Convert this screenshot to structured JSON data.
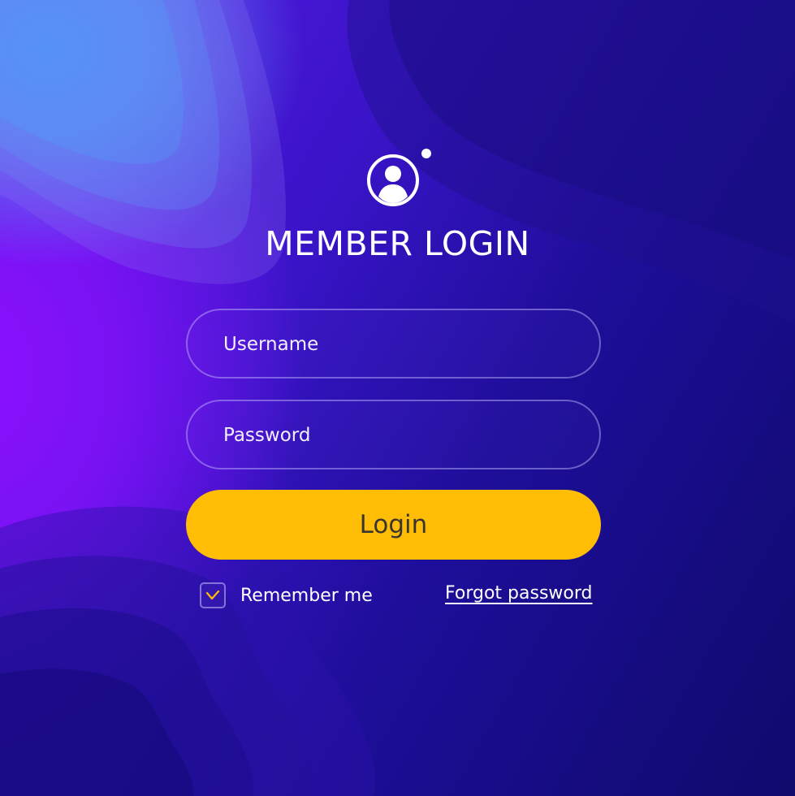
{
  "header": {
    "title": "MEMBER LOGIN",
    "avatar_icon": "user-circle-icon"
  },
  "form": {
    "username_placeholder": "Username",
    "password_placeholder": "Password",
    "login_label": "Login",
    "remember_label": "Remember me",
    "remember_checked": true,
    "forgot_label": "Forgot password"
  },
  "colors": {
    "accent": "#ffbd06",
    "background_dark": "#0f0a6c",
    "background_purple": "#8a10ff",
    "background_blue": "#3f8cf5",
    "checkmark": "#ffbd06",
    "text": "#ffffff"
  }
}
